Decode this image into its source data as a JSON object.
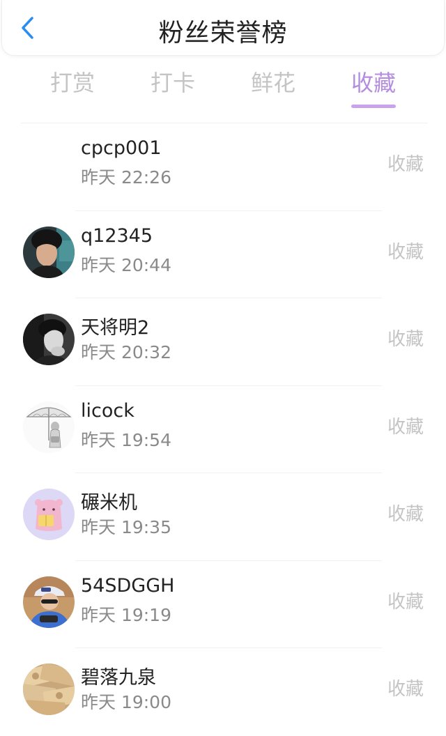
{
  "header": {
    "title": "粉丝荣誉榜",
    "back_icon": "chevron-left-icon",
    "accent_color": "#2a8df0"
  },
  "tabs": [
    {
      "label": "打赏",
      "active": false
    },
    {
      "label": "打卡",
      "active": false
    },
    {
      "label": "鲜花",
      "active": false
    },
    {
      "label": "收藏",
      "active": true
    }
  ],
  "theme": {
    "active_tab_color": "#b48de0",
    "inactive_text_color": "#c4c4c4"
  },
  "fans": [
    {
      "name": "cpcp001",
      "time": "昨天 22:26",
      "action": "收藏",
      "avatar": "none"
    },
    {
      "name": "q12345",
      "time": "昨天 20:44",
      "action": "收藏",
      "avatar": "man-portrait-avatar"
    },
    {
      "name": "天将明2",
      "time": "昨天 20:32",
      "action": "收藏",
      "avatar": "monochrome-portrait-avatar"
    },
    {
      "name": "licock",
      "time": "昨天 19:54",
      "action": "收藏",
      "avatar": "umbrella-girl-sketch-avatar"
    },
    {
      "name": "碾米机",
      "time": "昨天 19:35",
      "action": "收藏",
      "avatar": "pink-cartoon-avatar"
    },
    {
      "name": "54SDGGH",
      "time": "昨天 19:19",
      "action": "收藏",
      "avatar": "boy-cap-avatar"
    },
    {
      "name": "碧落九泉",
      "time": "昨天 19:00",
      "action": "收藏",
      "avatar": "banknotes-avatar"
    }
  ]
}
